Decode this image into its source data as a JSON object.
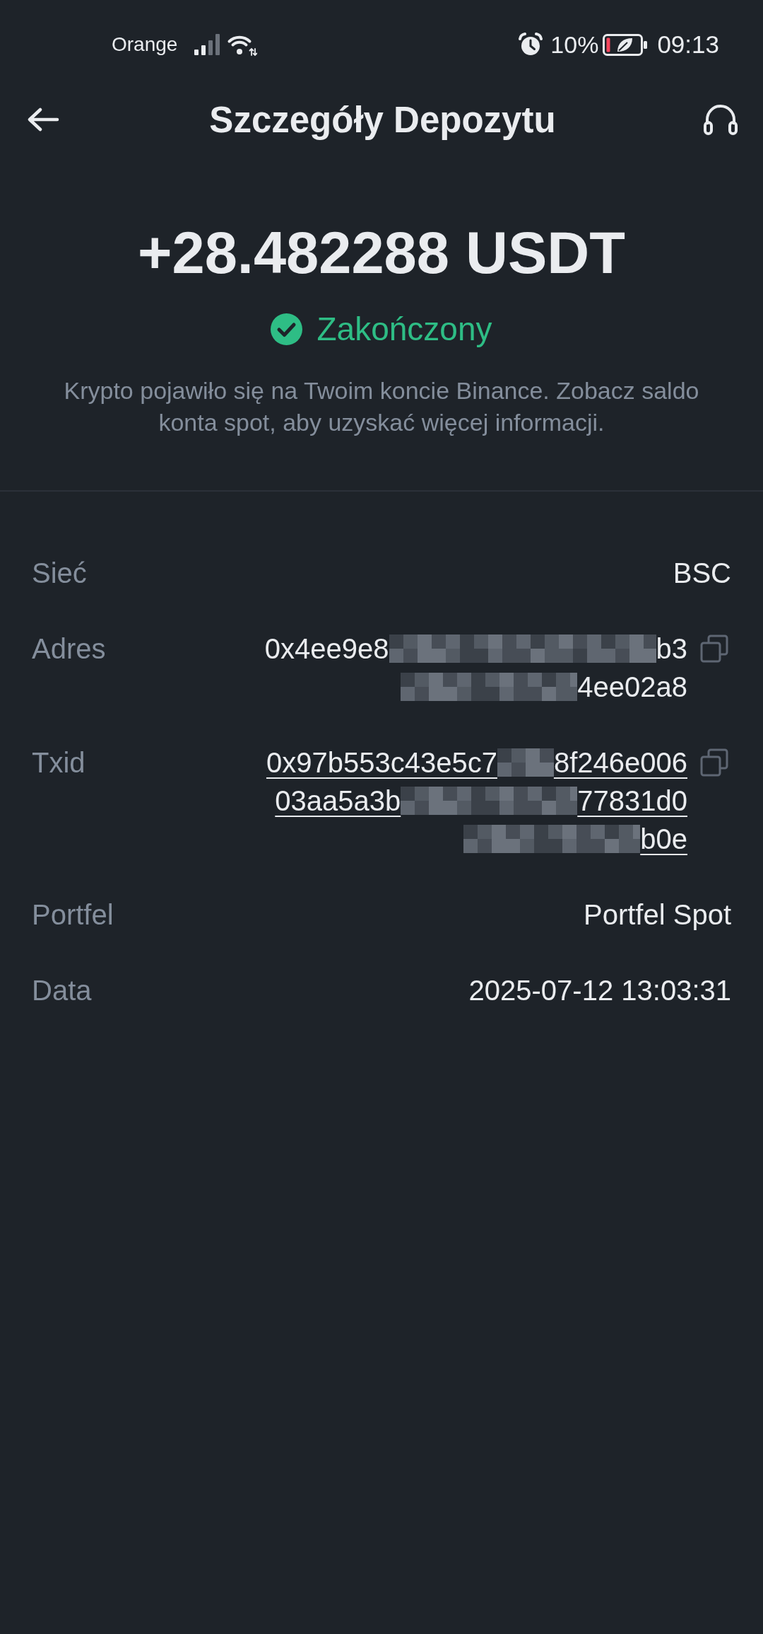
{
  "status_bar": {
    "carrier": "Orange",
    "battery_text": "10%",
    "time": "09:13"
  },
  "header": {
    "title": "Szczegóły Depozytu"
  },
  "summary": {
    "amount": "+28.482288 USDT",
    "status": {
      "label": "Zakończony",
      "kind": "success"
    },
    "note": "Krypto pojawiło się na Twoim koncie Binance. Zobacz saldo konta spot, aby uzyskać więcej informacji."
  },
  "details": [
    {
      "label": "Sieć",
      "kind": "text",
      "value": "BSC"
    },
    {
      "label": "Adres",
      "kind": "hash",
      "link": false,
      "lines": [
        {
          "segments": [
            {
              "kind": "text",
              "text": "0x4ee9e8"
            },
            {
              "kind": "longmask"
            },
            {
              "kind": "text",
              "text": "b3"
            }
          ]
        },
        {
          "segments": [
            {
              "kind": "midmask"
            },
            {
              "kind": "text",
              "text": "4ee02a8"
            }
          ]
        }
      ]
    },
    {
      "label": "Txid",
      "kind": "hash",
      "link": true,
      "lines": [
        {
          "segments": [
            {
              "kind": "text",
              "text": "0x97b553c43e5c7"
            },
            {
              "kind": "shortmask"
            },
            {
              "kind": "text",
              "text": "8f246e006"
            }
          ]
        },
        {
          "segments": [
            {
              "kind": "text",
              "text": "03aa5a3b"
            },
            {
              "kind": "midmask"
            },
            {
              "kind": "text",
              "text": "77831d0"
            }
          ]
        },
        {
          "segments": [
            {
              "kind": "midmask"
            },
            {
              "kind": "text",
              "text": "b0e"
            }
          ]
        }
      ]
    },
    {
      "label": "Portfel",
      "kind": "text",
      "value": "Portfel Spot"
    },
    {
      "label": "Data",
      "kind": "text",
      "value": "2025-07-12 13:03:31"
    }
  ]
}
